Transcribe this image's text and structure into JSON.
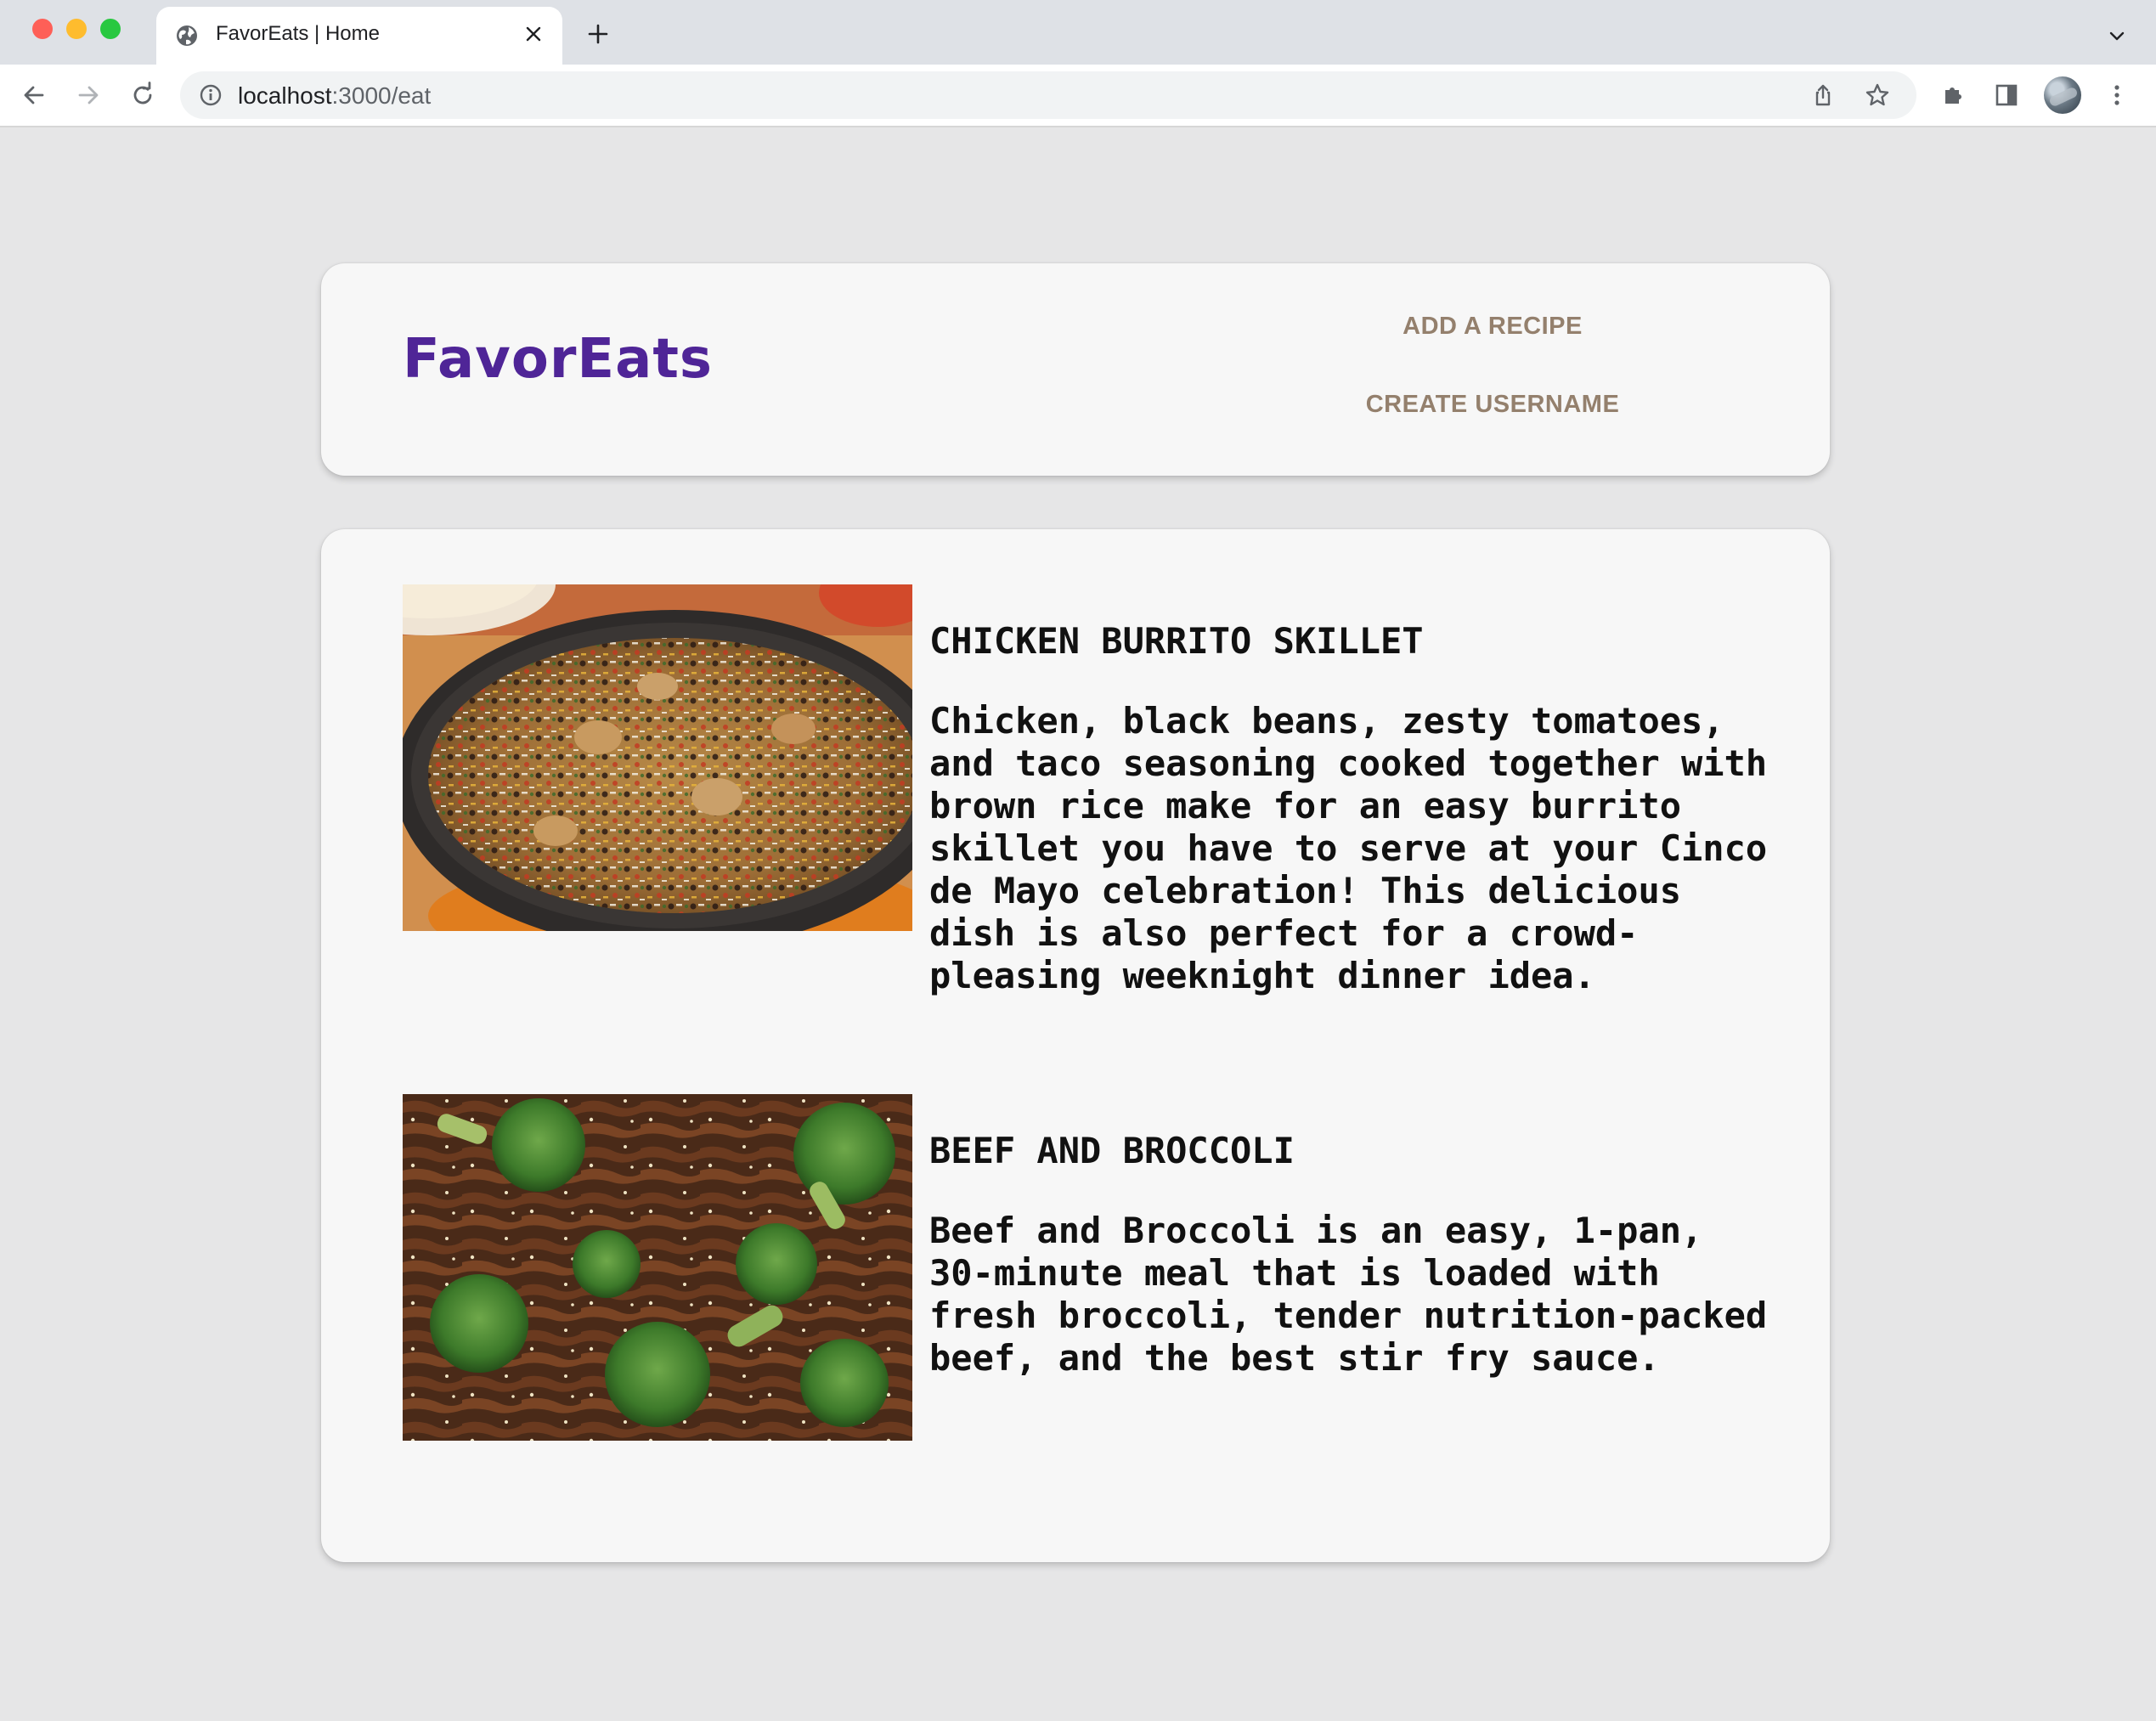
{
  "browser": {
    "tab_title": "FavorEats | Home",
    "url_host": "localhost",
    "url_path": ":3000/eat"
  },
  "header": {
    "logo": "FavorEats",
    "nav": {
      "add_recipe": "ADD A RECIPE",
      "create_username": "CREATE USERNAME"
    }
  },
  "recipes": [
    {
      "title": "CHICKEN BURRITO SKILLET",
      "description": "Chicken, black beans, zesty tomatoes, and taco seasoning cooked together with brown rice make for an easy burrito skillet you have to serve at your Cinco de Mayo celebration! This delicious dish is also perfect for a crowd-pleasing weeknight dinner idea."
    },
    {
      "title": "BEEF AND BROCCOLI",
      "description": "Beef and Broccoli is an easy, 1-pan, 30-minute meal that is loaded with fresh broccoli, tender nutrition-packed beef, and the best stir fry sauce."
    }
  ],
  "colors": {
    "logo": "#4f2597",
    "nav_link": "#94806d",
    "page_bg": "#e6e6e7",
    "card_bg": "#f7f7f7"
  },
  "icons": {
    "tab_favicon": "globe-icon",
    "tab_close": "close-icon",
    "new_tab": "plus-icon",
    "back": "arrow-left-icon",
    "forward": "arrow-right-icon",
    "reload": "reload-icon",
    "site_info": "info-icon",
    "share": "share-icon",
    "bookmark": "star-icon",
    "extensions": "puzzle-icon",
    "side_panel": "side-panel-icon",
    "menu": "kebab-menu-icon"
  }
}
